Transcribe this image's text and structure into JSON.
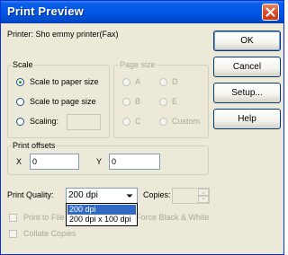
{
  "window": {
    "title": "Print Preview"
  },
  "printer_line": "Printer: Sho  emmy  printer(Fax)",
  "buttons": {
    "ok": "OK",
    "cancel": "Cancel",
    "setup": "Setup...",
    "help": "Help"
  },
  "scale": {
    "label": "Scale",
    "options": [
      "Scale to paper size",
      "Scale to page size",
      "Scaling:"
    ],
    "selected": "Scale to paper size",
    "scaling_value": ""
  },
  "page_size": {
    "label": "Page size",
    "options": [
      "A",
      "D",
      "B",
      "E",
      "C",
      "Custom"
    ]
  },
  "print_offsets": {
    "label": "Print offsets",
    "x_label": "X",
    "x_value": "0",
    "y_label": "Y",
    "y_value": "0"
  },
  "print_quality": {
    "label": "Print Quality:",
    "value": "200 dpi",
    "options": [
      "200 dpi",
      "200 dpi x 100 dpi"
    ],
    "highlighted": "200 dpi"
  },
  "copies": {
    "label": "Copies:",
    "value": ""
  },
  "checkboxes": {
    "print_to_file": "Print to File",
    "force_bw": "Force Black & White",
    "collate": "Collate Copies"
  },
  "colors": {
    "title_bar": "#0056e5",
    "selection": "#316ac5",
    "dialog_bg": "#ece9d8"
  }
}
